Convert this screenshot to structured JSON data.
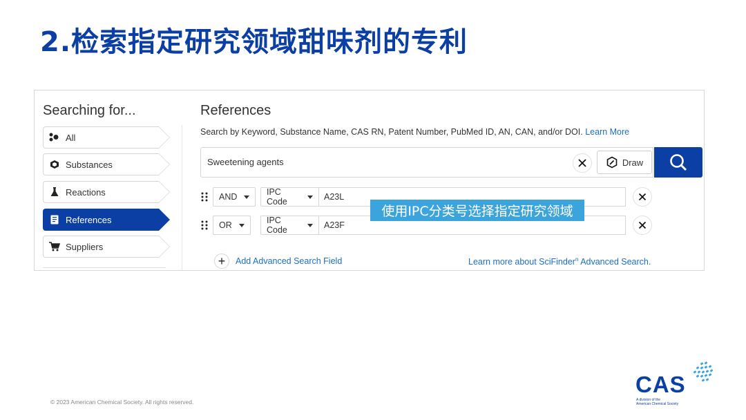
{
  "slide": {
    "title": "2.检索指定研究领域甜味剂的专利",
    "copyright": "© 2023 American Chemical Society. All rights reserved."
  },
  "left": {
    "heading": "Searching for...",
    "items": [
      {
        "label": "All",
        "icon": "all-icon"
      },
      {
        "label": "Substances",
        "icon": "substance-icon"
      },
      {
        "label": "Reactions",
        "icon": "flask-icon"
      },
      {
        "label": "References",
        "icon": "document-icon",
        "active": true
      },
      {
        "label": "Suppliers",
        "icon": "cart-icon"
      }
    ]
  },
  "right": {
    "heading": "References",
    "hint": "Search by Keyword, Substance Name, CAS RN, Patent Number, PubMed ID, AN, CAN, and/or DOI.",
    "hint_link": "Learn More",
    "search_value": "Sweetening agents",
    "draw_label": "Draw",
    "rows": [
      {
        "operator": "AND",
        "field": "IPC Code",
        "value": "A23L"
      },
      {
        "operator": "OR",
        "field": "IPC Code",
        "value": "A23F"
      }
    ],
    "add_field_label": "Add Advanced Search Field",
    "learn_more_prefix": "Learn more about SciFinder",
    "learn_more_sup": "n",
    "learn_more_suffix": " Advanced Search."
  },
  "annotation": "使用IPC分类号选择指定研究领域",
  "logo": {
    "text": "CAS",
    "sub_line1": "A division of the",
    "sub_line2": "American Chemical Society"
  },
  "colors": {
    "brand_blue": "#0b3fa3",
    "link_blue": "#1a6fc4",
    "annotation_bg": "#3ba4dd"
  }
}
